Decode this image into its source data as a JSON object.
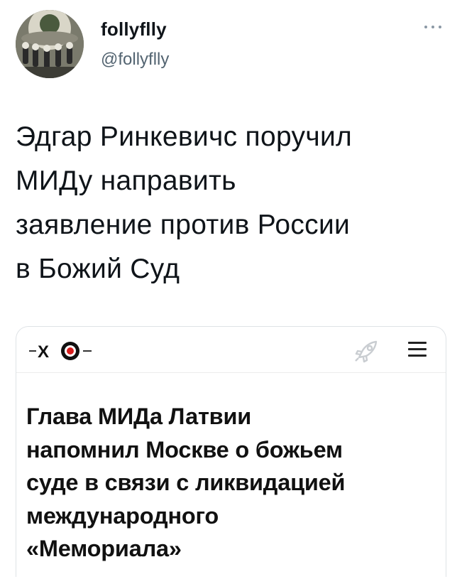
{
  "user": {
    "display_name": "follyflly",
    "handle": "@follyflly",
    "avatar_icon": "avatar-image"
  },
  "tweet": {
    "lines": [
      "Эдгар Ринкевичс поручил",
      "МИДу направить",
      "заявление против России",
      "в Божий Суд"
    ]
  },
  "card": {
    "site_logo": "logo-icon",
    "headline_lines": [
      "Глава МИДа Латвии",
      "напомнил Москве о божьем",
      "суде в связи с ликвидацией",
      "международного",
      "«Мемориала»"
    ]
  },
  "colors": {
    "text": "#0f1419",
    "secondary": "#536471",
    "card_border": "#dfe3e6",
    "logo_red": "#d81e1e"
  }
}
